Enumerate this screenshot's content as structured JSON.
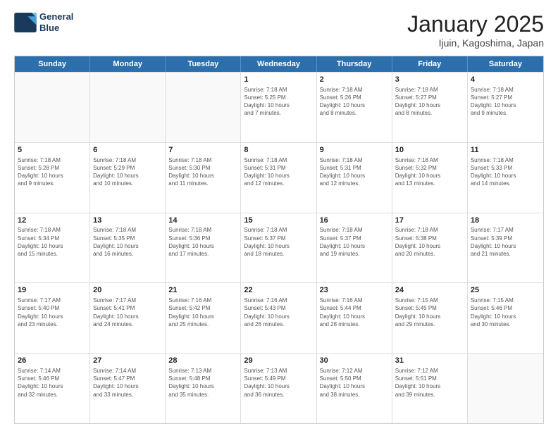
{
  "header": {
    "logo_line1": "General",
    "logo_line2": "Blue",
    "title": "January 2025",
    "subtitle": "Ijuin, Kagoshima, Japan"
  },
  "weekdays": [
    "Sunday",
    "Monday",
    "Tuesday",
    "Wednesday",
    "Thursday",
    "Friday",
    "Saturday"
  ],
  "rows": [
    [
      {
        "day": "",
        "info": ""
      },
      {
        "day": "",
        "info": ""
      },
      {
        "day": "",
        "info": ""
      },
      {
        "day": "1",
        "info": "Sunrise: 7:18 AM\nSunset: 5:25 PM\nDaylight: 10 hours\nand 7 minutes."
      },
      {
        "day": "2",
        "info": "Sunrise: 7:18 AM\nSunset: 5:26 PM\nDaylight: 10 hours\nand 8 minutes."
      },
      {
        "day": "3",
        "info": "Sunrise: 7:18 AM\nSunset: 5:27 PM\nDaylight: 10 hours\nand 8 minutes."
      },
      {
        "day": "4",
        "info": "Sunrise: 7:18 AM\nSunset: 5:27 PM\nDaylight: 10 hours\nand 9 minutes."
      }
    ],
    [
      {
        "day": "5",
        "info": "Sunrise: 7:18 AM\nSunset: 5:28 PM\nDaylight: 10 hours\nand 9 minutes."
      },
      {
        "day": "6",
        "info": "Sunrise: 7:18 AM\nSunset: 5:29 PM\nDaylight: 10 hours\nand 10 minutes."
      },
      {
        "day": "7",
        "info": "Sunrise: 7:18 AM\nSunset: 5:30 PM\nDaylight: 10 hours\nand 11 minutes."
      },
      {
        "day": "8",
        "info": "Sunrise: 7:18 AM\nSunset: 5:31 PM\nDaylight: 10 hours\nand 12 minutes."
      },
      {
        "day": "9",
        "info": "Sunrise: 7:18 AM\nSunset: 5:31 PM\nDaylight: 10 hours\nand 12 minutes."
      },
      {
        "day": "10",
        "info": "Sunrise: 7:18 AM\nSunset: 5:32 PM\nDaylight: 10 hours\nand 13 minutes."
      },
      {
        "day": "11",
        "info": "Sunrise: 7:18 AM\nSunset: 5:33 PM\nDaylight: 10 hours\nand 14 minutes."
      }
    ],
    [
      {
        "day": "12",
        "info": "Sunrise: 7:18 AM\nSunset: 5:34 PM\nDaylight: 10 hours\nand 15 minutes."
      },
      {
        "day": "13",
        "info": "Sunrise: 7:18 AM\nSunset: 5:35 PM\nDaylight: 10 hours\nand 16 minutes."
      },
      {
        "day": "14",
        "info": "Sunrise: 7:18 AM\nSunset: 5:36 PM\nDaylight: 10 hours\nand 17 minutes."
      },
      {
        "day": "15",
        "info": "Sunrise: 7:18 AM\nSunset: 5:37 PM\nDaylight: 10 hours\nand 18 minutes."
      },
      {
        "day": "16",
        "info": "Sunrise: 7:18 AM\nSunset: 5:37 PM\nDaylight: 10 hours\nand 19 minutes."
      },
      {
        "day": "17",
        "info": "Sunrise: 7:18 AM\nSunset: 5:38 PM\nDaylight: 10 hours\nand 20 minutes."
      },
      {
        "day": "18",
        "info": "Sunrise: 7:17 AM\nSunset: 5:39 PM\nDaylight: 10 hours\nand 21 minutes."
      }
    ],
    [
      {
        "day": "19",
        "info": "Sunrise: 7:17 AM\nSunset: 5:40 PM\nDaylight: 10 hours\nand 23 minutes."
      },
      {
        "day": "20",
        "info": "Sunrise: 7:17 AM\nSunset: 5:41 PM\nDaylight: 10 hours\nand 24 minutes."
      },
      {
        "day": "21",
        "info": "Sunrise: 7:16 AM\nSunset: 5:42 PM\nDaylight: 10 hours\nand 25 minutes."
      },
      {
        "day": "22",
        "info": "Sunrise: 7:16 AM\nSunset: 5:43 PM\nDaylight: 10 hours\nand 26 minutes."
      },
      {
        "day": "23",
        "info": "Sunrise: 7:16 AM\nSunset: 5:44 PM\nDaylight: 10 hours\nand 28 minutes."
      },
      {
        "day": "24",
        "info": "Sunrise: 7:15 AM\nSunset: 5:45 PM\nDaylight: 10 hours\nand 29 minutes."
      },
      {
        "day": "25",
        "info": "Sunrise: 7:15 AM\nSunset: 5:46 PM\nDaylight: 10 hours\nand 30 minutes."
      }
    ],
    [
      {
        "day": "26",
        "info": "Sunrise: 7:14 AM\nSunset: 5:46 PM\nDaylight: 10 hours\nand 32 minutes."
      },
      {
        "day": "27",
        "info": "Sunrise: 7:14 AM\nSunset: 5:47 PM\nDaylight: 10 hours\nand 33 minutes."
      },
      {
        "day": "28",
        "info": "Sunrise: 7:13 AM\nSunset: 5:48 PM\nDaylight: 10 hours\nand 35 minutes."
      },
      {
        "day": "29",
        "info": "Sunrise: 7:13 AM\nSunset: 5:49 PM\nDaylight: 10 hours\nand 36 minutes."
      },
      {
        "day": "30",
        "info": "Sunrise: 7:12 AM\nSunset: 5:50 PM\nDaylight: 10 hours\nand 38 minutes."
      },
      {
        "day": "31",
        "info": "Sunrise: 7:12 AM\nSunset: 5:51 PM\nDaylight: 10 hours\nand 39 minutes."
      },
      {
        "day": "",
        "info": ""
      }
    ]
  ]
}
